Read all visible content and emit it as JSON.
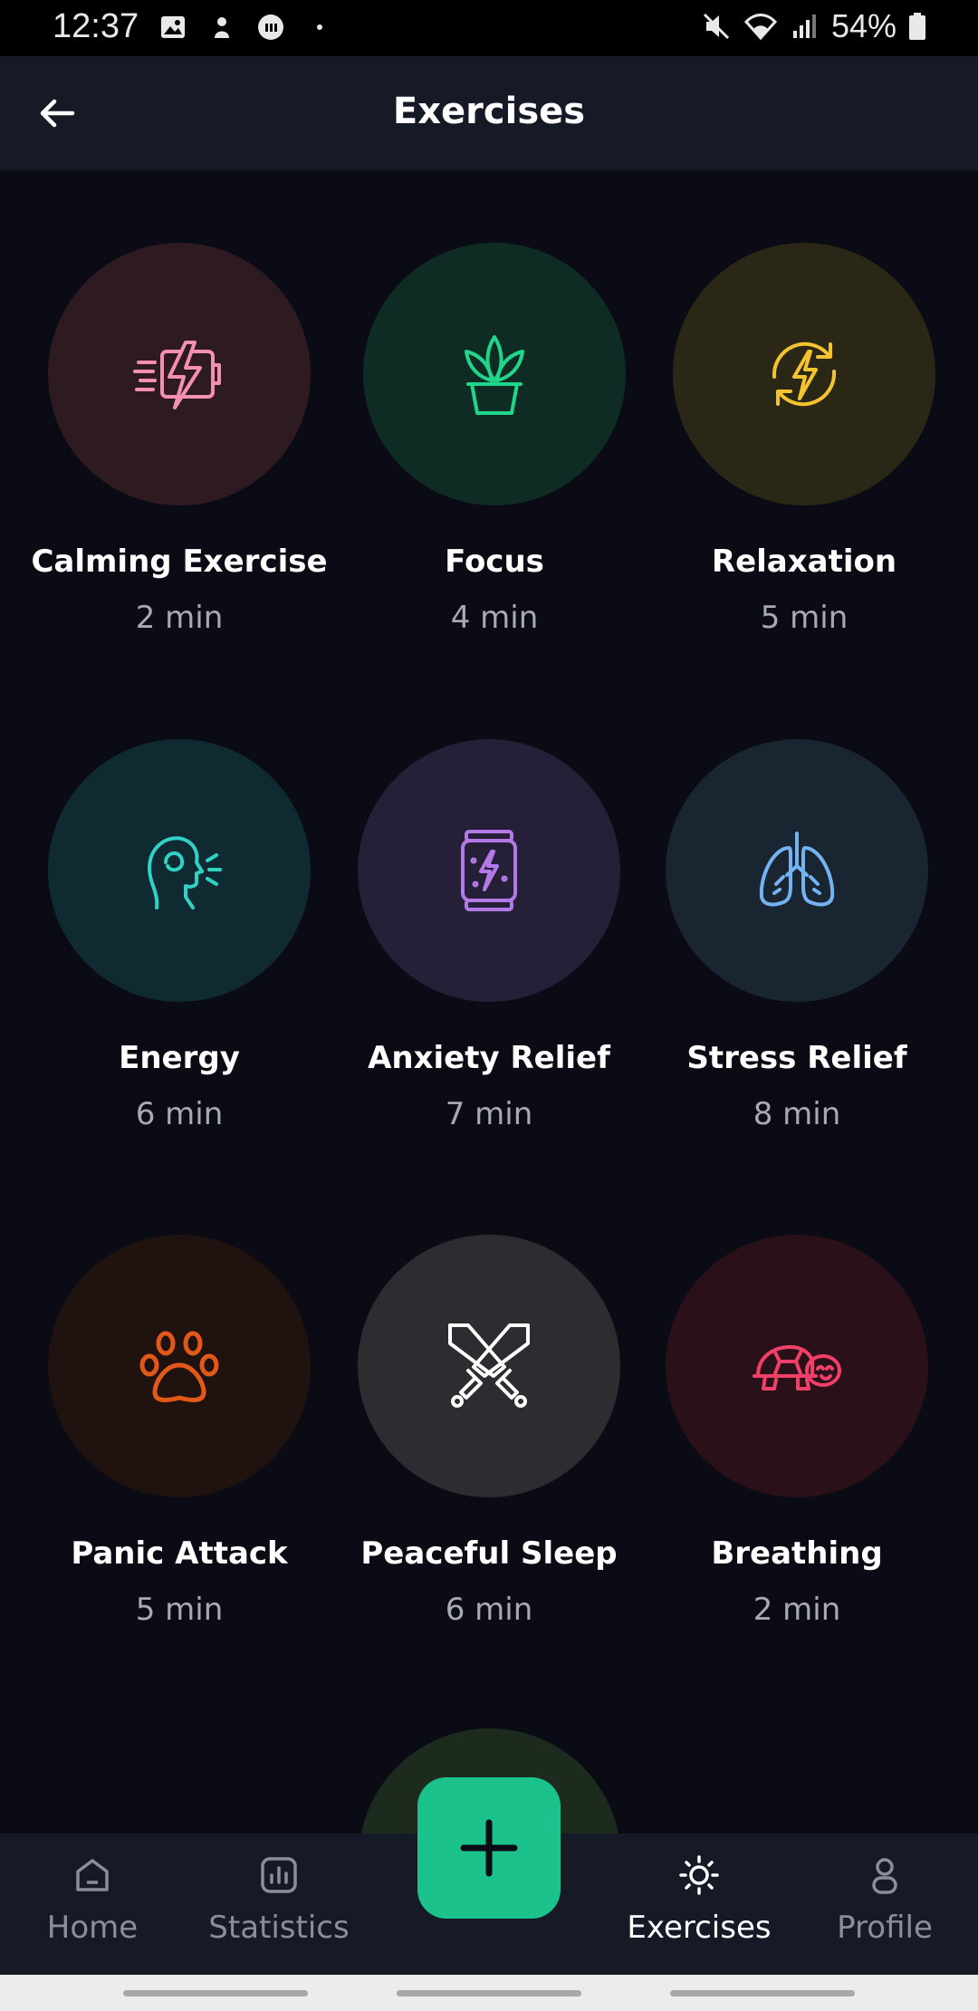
{
  "status": {
    "time": "12:37",
    "battery": "54%"
  },
  "header": {
    "title": "Exercises"
  },
  "exercises": [
    {
      "title": "Calming Exercise",
      "duration": "2 min",
      "icon": "battery-bolt-icon",
      "bg": "#2e1a21",
      "fg": "#f48fb1"
    },
    {
      "title": "Focus",
      "duration": "4 min",
      "icon": "plant-pot-icon",
      "bg": "#0f2c24",
      "fg": "#1fd68a"
    },
    {
      "title": "Relaxation",
      "duration": "5 min",
      "icon": "energy-cycle-icon",
      "bg": "#2b2716",
      "fg": "#f4c430"
    },
    {
      "title": "Energy",
      "duration": "6 min",
      "icon": "head-breath-icon",
      "bg": "#0f2a30",
      "fg": "#2fd3c6"
    },
    {
      "title": "Anxiety Relief",
      "duration": "7 min",
      "icon": "energy-can-icon",
      "bg": "#261f38",
      "fg": "#b379e6"
    },
    {
      "title": "Stress Relief",
      "duration": "8 min",
      "icon": "lungs-icon",
      "bg": "#1a2532",
      "fg": "#74b3f2"
    },
    {
      "title": "Panic Attack",
      "duration": "5 min",
      "icon": "paw-icon",
      "bg": "#20130f",
      "fg": "#e2581a"
    },
    {
      "title": "Peaceful Sleep",
      "duration": "6 min",
      "icon": "crossed-swords-icon",
      "bg": "#2d2d31",
      "fg": "#ffffff"
    },
    {
      "title": "Breathing",
      "duration": "2 min",
      "icon": "turtle-icon",
      "bg": "#2a1018",
      "fg": "#f0406a"
    }
  ],
  "nav": {
    "home": "Home",
    "statistics": "Statistics",
    "exercises": "Exercises",
    "profile": "Profile"
  },
  "colors": {
    "background": "#0a0b14",
    "header": "#161a26",
    "accent": "#1cc28c",
    "muted_text": "#a8aab2"
  }
}
